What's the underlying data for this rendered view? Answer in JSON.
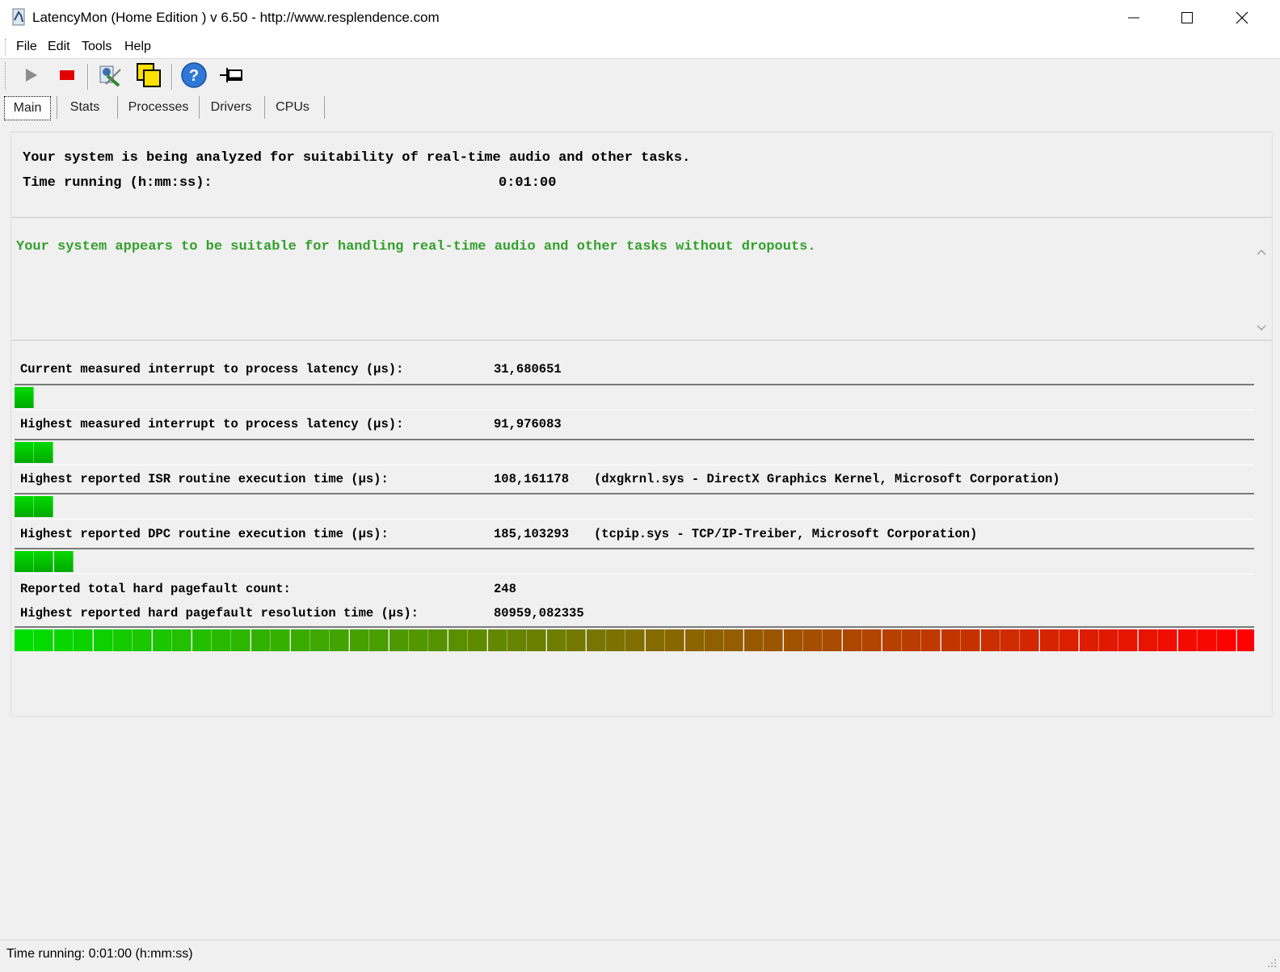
{
  "window": {
    "title": "LatencyMon  (Home Edition )  v 6.50 - http://www.resplendence.com",
    "icons": [
      "app-icon",
      "minimize-icon",
      "maximize-icon",
      "close-icon"
    ]
  },
  "menu": {
    "file": "File",
    "edit": "Edit",
    "tools": "Tools",
    "help": "Help"
  },
  "toolbar": {
    "icons": [
      "play-icon",
      "stop-icon",
      "wrench-icon",
      "copy-windows-icon",
      "help-icon",
      "pin-icon"
    ]
  },
  "tabs": {
    "main": "Main",
    "stats": "Stats",
    "processes": "Processes",
    "drivers": "Drivers",
    "cpus": "CPUs"
  },
  "status": {
    "analysis_text": "Your system is being analyzed for suitability of real-time audio and other tasks.",
    "time_label": "Time running (h:mm:ss):",
    "time_value": "0:01:00"
  },
  "verdict": {
    "text": "Your system appears to be suitable for handling real-time audio and other tasks without dropouts.",
    "color": "#33a02c"
  },
  "metrics": {
    "current_latency": {
      "label": "Current measured interrupt to process latency (µs):",
      "value": "31,680651",
      "bar_segments": 1
    },
    "highest_latency": {
      "label": "Highest measured interrupt to process latency (µs):",
      "value": "91,976083",
      "bar_segments": 2
    },
    "isr": {
      "label": "Highest reported ISR routine execution time (µs):",
      "value": "108,161178",
      "extra": "(dxgkrnl.sys - DirectX Graphics Kernel, Microsoft Corporation)",
      "bar_segments": 2
    },
    "dpc": {
      "label": "Highest reported DPC routine execution time (µs):",
      "value": "185,103293",
      "extra": "(tcpip.sys - TCP/IP-Treiber, Microsoft Corporation)",
      "bar_segments": 3
    },
    "pagefault_count": {
      "label": "Reported total hard pagefault count:",
      "value": "248"
    },
    "pagefault_time": {
      "label": "Highest reported hard pagefault resolution time (µs):",
      "value": "80959,082335",
      "bar_segments": 63
    }
  },
  "statusbar": {
    "text": "Time running: 0:01:00  (h:mm:ss)"
  },
  "colors": {
    "bar_green": "#00dd00",
    "bar_red": "#ff0000"
  }
}
